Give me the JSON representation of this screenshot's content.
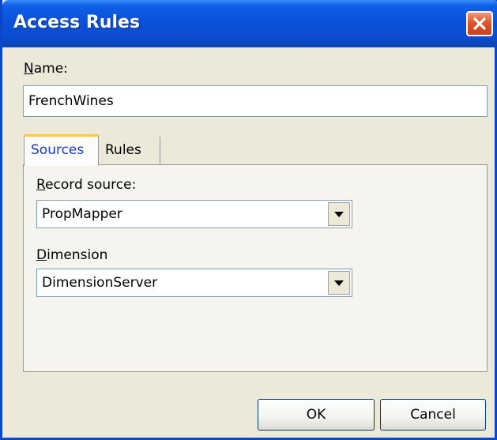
{
  "window": {
    "title": "Access Rules"
  },
  "name_field": {
    "label_first": "N",
    "label_rest": "ame:",
    "value": "FrenchWines"
  },
  "tabs": [
    {
      "label": "Sources",
      "selected": true
    },
    {
      "label": "Rules",
      "selected": false
    }
  ],
  "record_source": {
    "label_first": "R",
    "label_rest": "ecord source:",
    "value": "PropMapper"
  },
  "dimension": {
    "label_first": "D",
    "label_rest": "imension",
    "value": "DimensionServer"
  },
  "buttons": {
    "ok": "OK",
    "cancel": "Cancel"
  },
  "colors": {
    "titlebar": "#0a51d8",
    "close": "#e2542a",
    "tab_accent": "#ffc83c",
    "selected_tab_text": "#1a3ac8"
  }
}
